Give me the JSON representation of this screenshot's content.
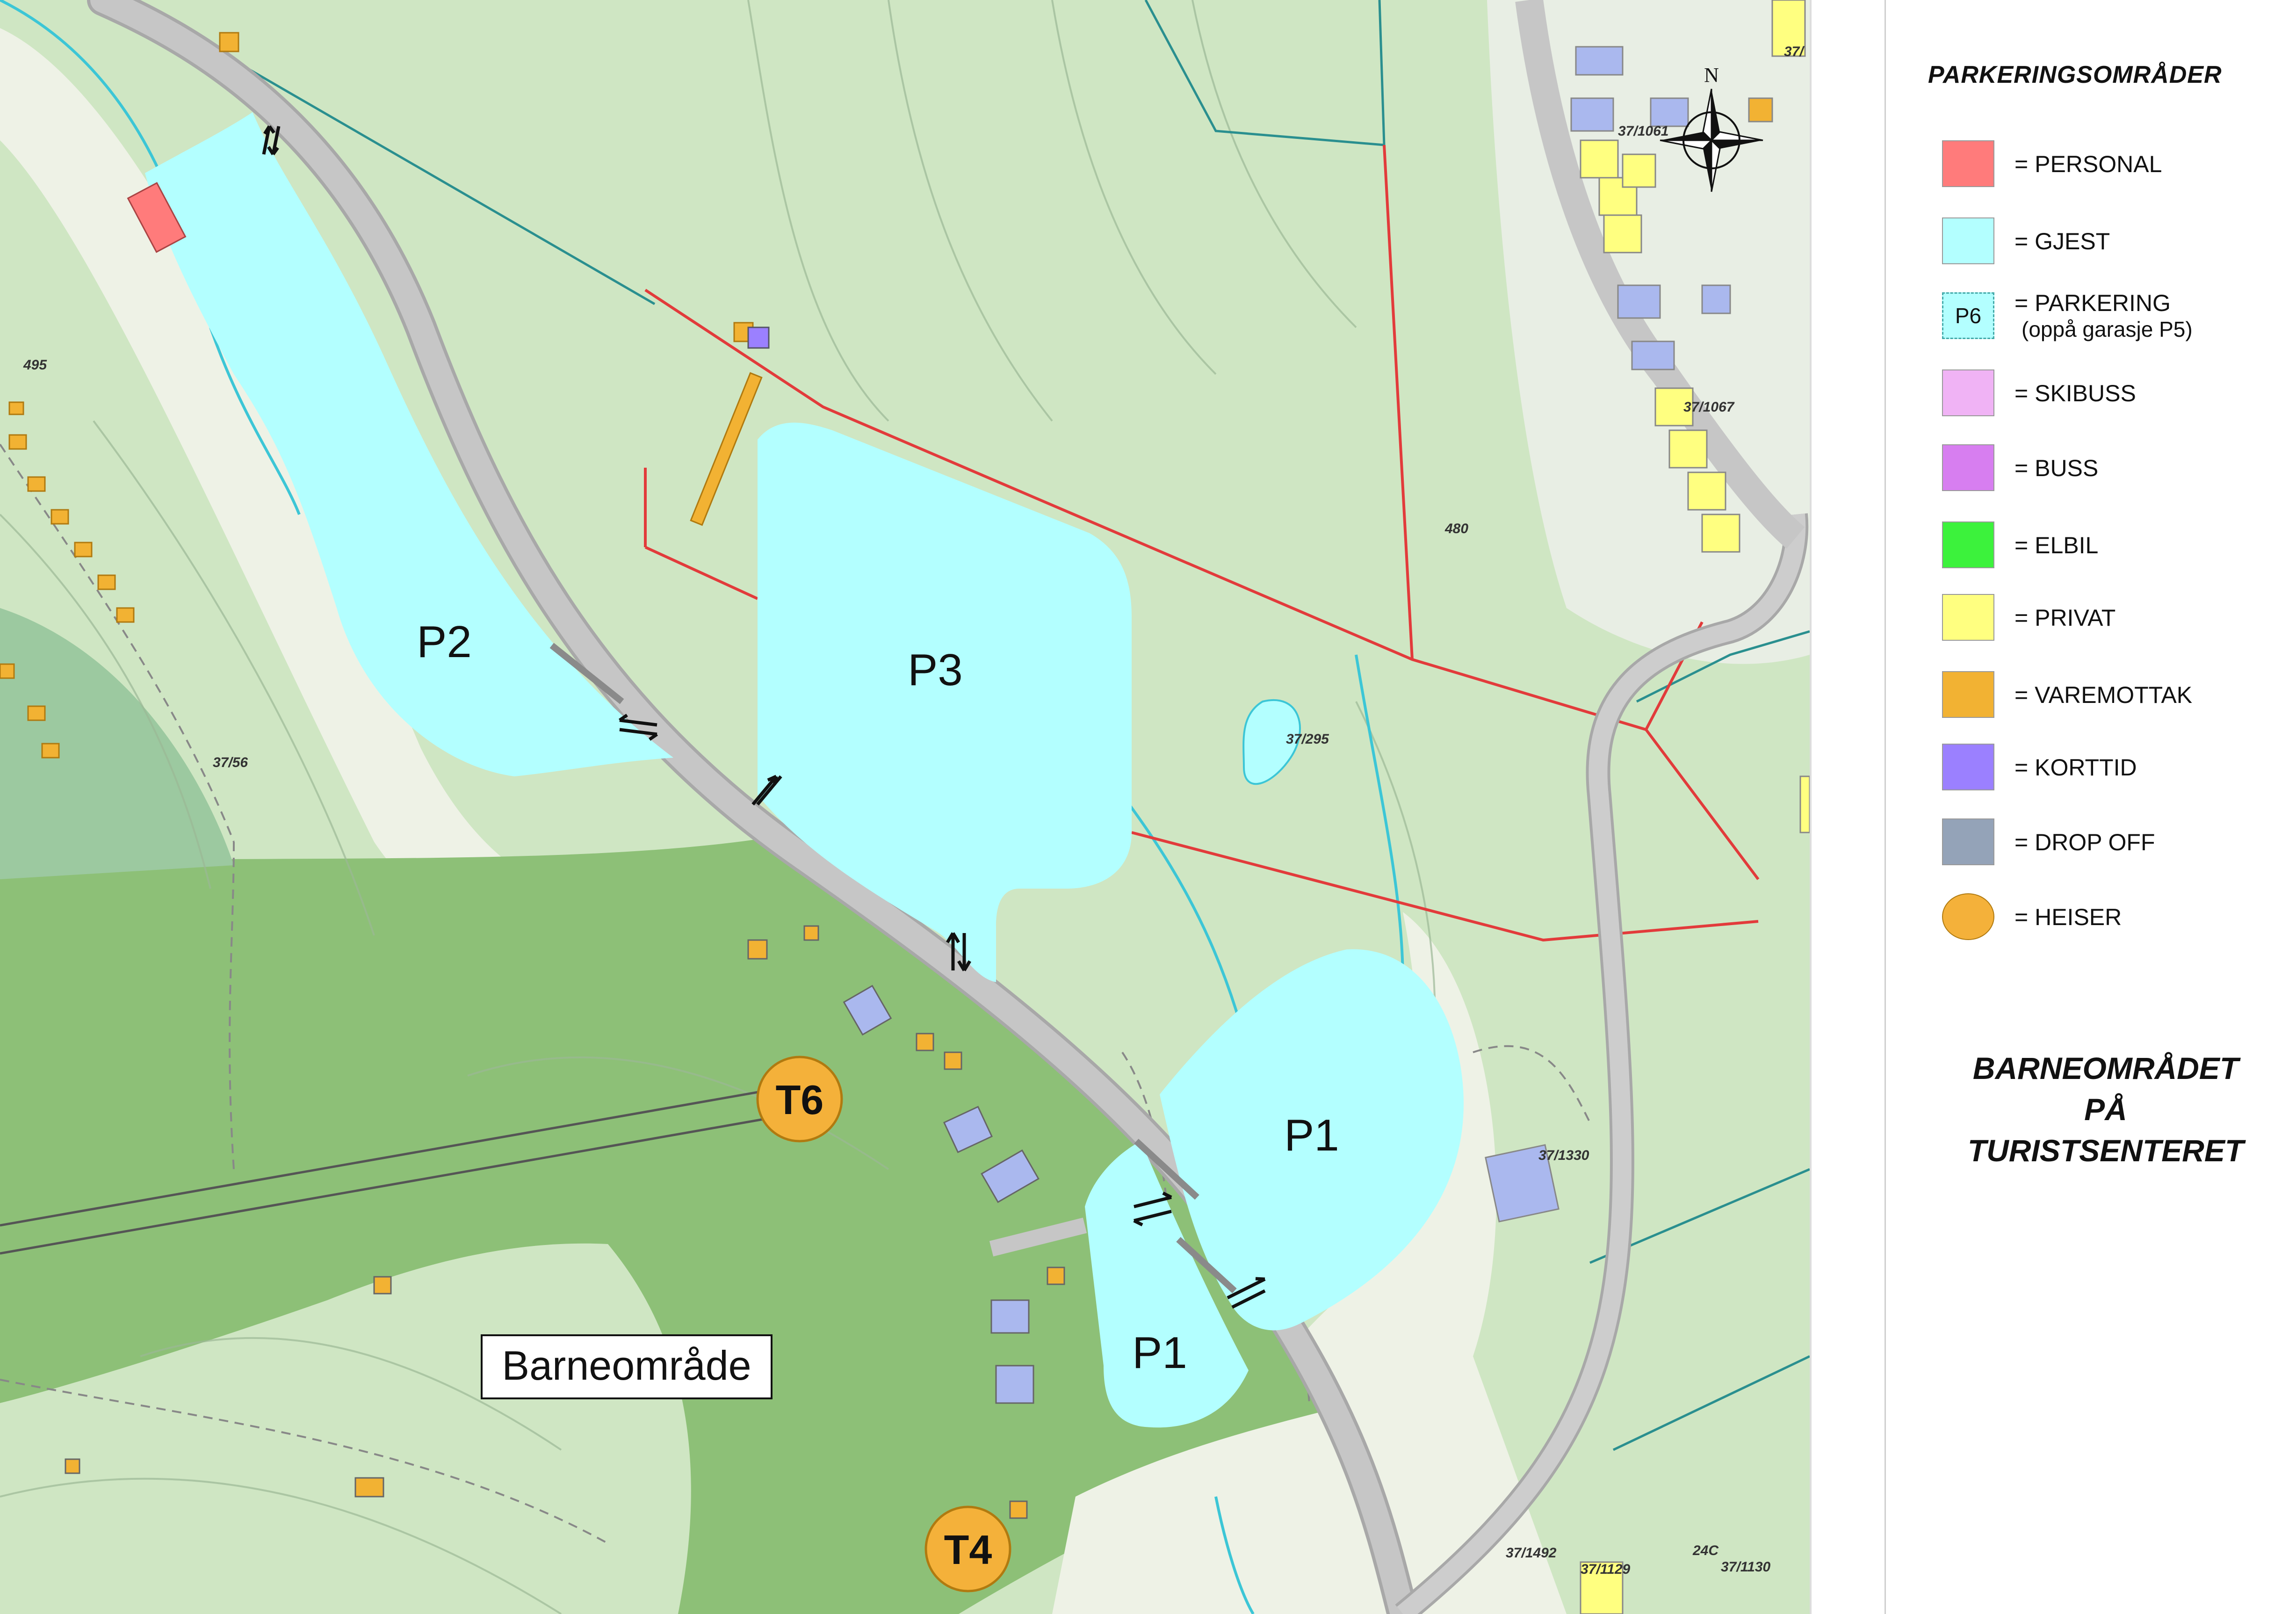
{
  "map": {
    "zones": [
      {
        "id": "P2",
        "label": "P2"
      },
      {
        "id": "P3",
        "label": "P3"
      },
      {
        "id": "P1a",
        "label": "P1"
      },
      {
        "id": "P1b",
        "label": "P1"
      }
    ],
    "lifts": [
      {
        "id": "T6",
        "label": "T6"
      },
      {
        "id": "T4",
        "label": "T4"
      }
    ],
    "area_label": "Barneområde",
    "compass_label": "N",
    "cadastral_labels": [
      "37/56",
      "37/295",
      "37/1067",
      "37/1061",
      "37/1330",
      "37/1492",
      "37/1129",
      "37/1130",
      "37/",
      "24C",
      "480",
      "495"
    ]
  },
  "legend": {
    "title": "PARKERINGSOMRÅDER",
    "items": [
      {
        "label": "= PERSONAL",
        "color": "#ff7b7b"
      },
      {
        "label": "= GJEST",
        "color": "#b3ffff"
      },
      {
        "label": "= PARKERING",
        "label2": "(oppå garasje P5)",
        "swatch_text": "P6",
        "color": "#b3ffff"
      },
      {
        "label": "= SKIBUSS",
        "color": "#f0b3f5"
      },
      {
        "label": "= BUSS",
        "color": "#d77ef0"
      },
      {
        "label": "= ELBIL",
        "color": "#3cf23c"
      },
      {
        "label": "= PRIVAT",
        "color": "#ffff80"
      },
      {
        "label": "= VAREMOTTAK",
        "color": "#f2b233"
      },
      {
        "label": "= KORTTID",
        "color": "#9b80ff"
      },
      {
        "label": "= DROP OFF",
        "color": "#94a3b8"
      },
      {
        "label": "= HEISER",
        "color": "#f4b13a"
      }
    ],
    "map_title": [
      "BARNEOMRÅDET",
      "PÅ",
      "TURISTSENTERET"
    ]
  },
  "colors": {
    "forest_light": "#cfe6c3",
    "forest_mid": "#a9d396",
    "forest_dark": "#8dc077",
    "open_land": "#eef2e6",
    "road": "#c2c2c2",
    "parking_guest": "#b3ffff",
    "boundary": "#e23b3b",
    "stream": "#3cc6d6",
    "building_blue": "#aab8ee",
    "building_yellow": "#ffff80",
    "building_orange": "#f2b233"
  }
}
